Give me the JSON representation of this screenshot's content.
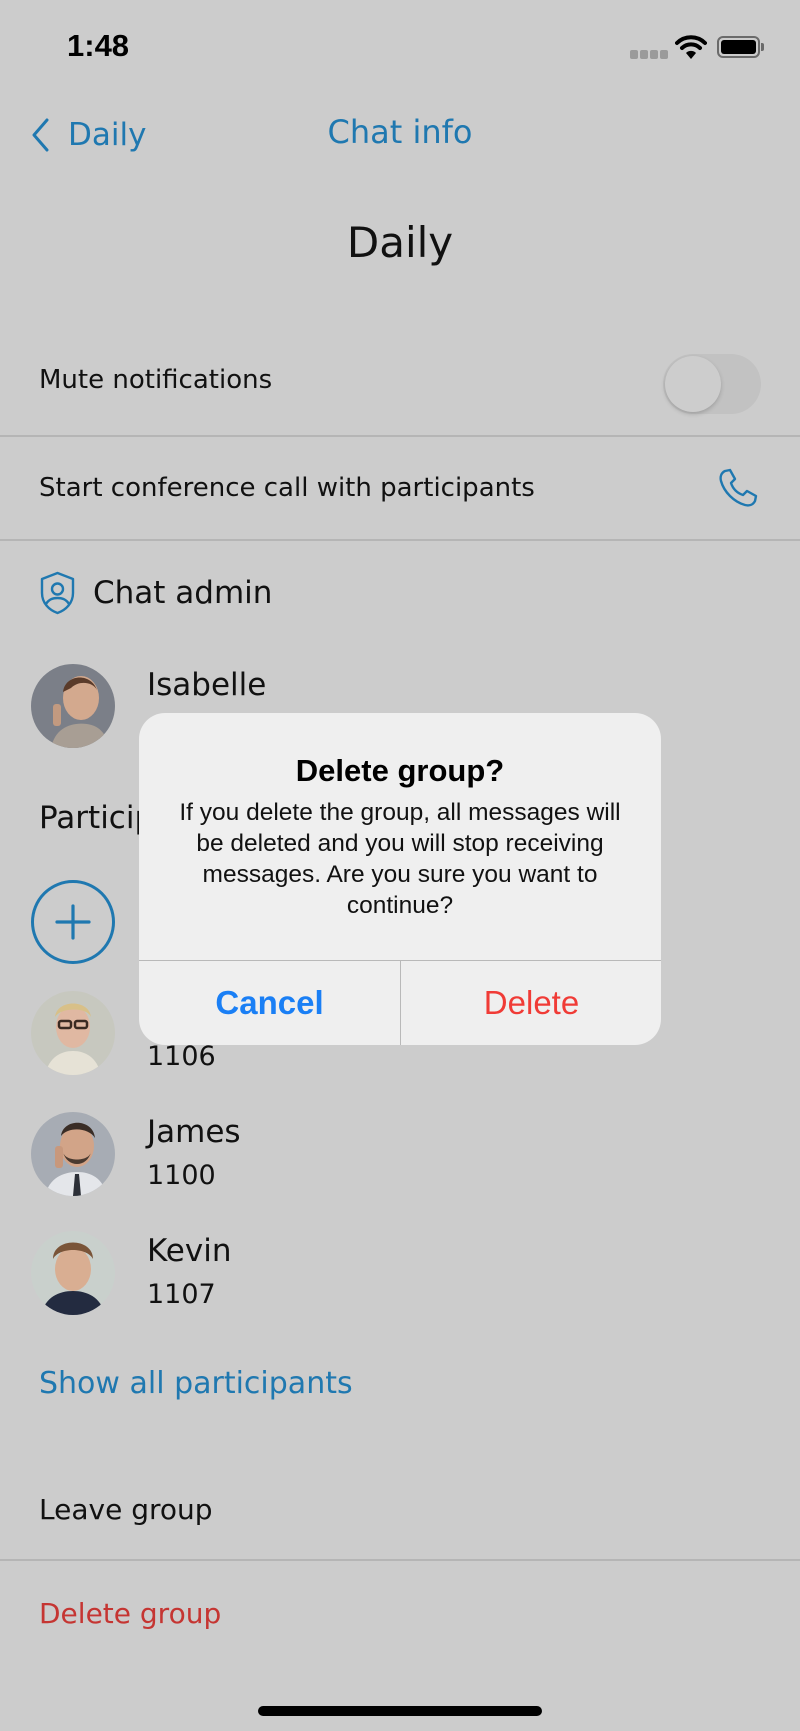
{
  "status_bar": {
    "time": "1:48",
    "icons": [
      "cellular-signal-icon",
      "wifi-icon",
      "battery-icon"
    ]
  },
  "nav": {
    "back_label": "Daily",
    "title": "Chat info"
  },
  "chat": {
    "name": "Daily"
  },
  "settings": {
    "mute_label": "Mute notifications",
    "mute_enabled": false,
    "conference_label": "Start conference call with participants"
  },
  "admin_section": {
    "title": "Chat admin",
    "admin": {
      "name": "Isabelle"
    }
  },
  "participants_section": {
    "title": "Participants",
    "items": [
      {
        "name": "",
        "ext": "1106"
      },
      {
        "name": "James",
        "ext": "1100"
      },
      {
        "name": "Kevin",
        "ext": "1107"
      }
    ],
    "show_all_label": "Show all participants"
  },
  "actions": {
    "leave_label": "Leave group",
    "delete_label": "Delete group"
  },
  "dialog": {
    "title": "Delete group?",
    "message": "If you delete the group, all messages will be deleted and you will stop receiving messages. Are you sure you want to continue?",
    "cancel_label": "Cancel",
    "delete_label": "Delete"
  },
  "colors": {
    "accent": "#1f78b0",
    "danger": "#c53532",
    "dialog_cancel": "#1a7ff5",
    "dialog_delete": "#f03b36",
    "background_dimmed": "#cccccc"
  }
}
